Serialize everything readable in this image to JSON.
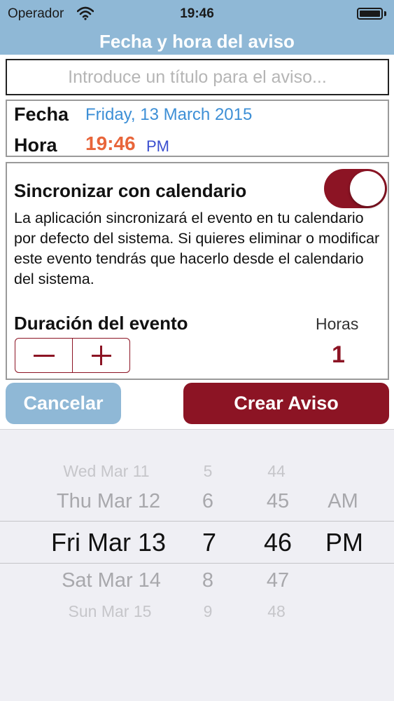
{
  "status_bar": {
    "carrier": "Operador",
    "time": "19:46"
  },
  "header": {
    "title": "Fecha y hora del aviso"
  },
  "title_input": {
    "placeholder": "Introduce un título para el aviso...",
    "value": ""
  },
  "datetime": {
    "date_label": "Fecha",
    "date_value": "Friday, 13 March 2015",
    "time_label": "Hora",
    "time_value": "19:46",
    "ampm": "PM"
  },
  "sync": {
    "title": "Sincronizar con calendario",
    "enabled": true,
    "description": "La aplicación sincronizará el evento en tu calendario por defecto del sistema. Si quieres eliminar o modificar este evento tendrás que hacerlo desde el calendario del sistema.",
    "duration_label": "Duración del evento",
    "hours_label": "Horas",
    "hours_value": "1"
  },
  "buttons": {
    "cancel": "Cancelar",
    "create": "Crear Aviso"
  },
  "picker": {
    "dates": [
      "Wed Mar 11",
      "Thu Mar 12",
      "Fri Mar 13",
      "Sat Mar 14",
      "Sun Mar 15"
    ],
    "hours": [
      "5",
      "6",
      "7",
      "8",
      "9"
    ],
    "minutes": [
      "44",
      "45",
      "46",
      "47",
      "48"
    ],
    "ampm": [
      "AM",
      "PM"
    ]
  },
  "colors": {
    "accent_dark_red": "#8c1424",
    "header_blue": "#8fb8d6",
    "date_blue": "#3d8fd6",
    "time_orange": "#e8653a"
  },
  "icons": {
    "wifi": "wifi-icon",
    "battery": "battery-icon",
    "minus": "minus-icon",
    "plus": "plus-icon"
  }
}
